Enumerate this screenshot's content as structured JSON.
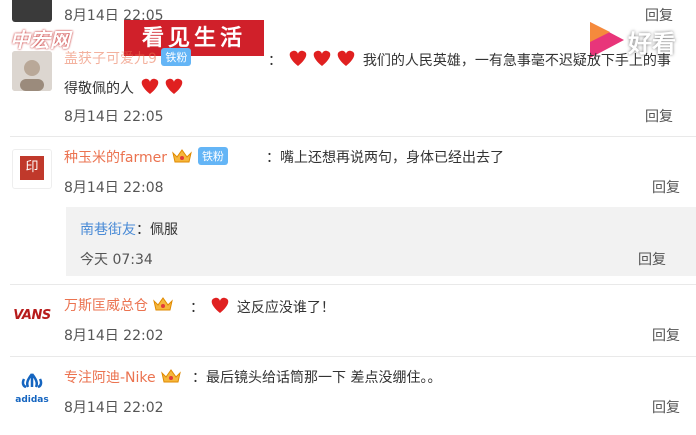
{
  "comments": [
    {
      "time": "8月14日 22:05",
      "reply": "回复"
    },
    {
      "name": "盖获子可爱九9",
      "badge": "铁粉",
      "text_before": "：",
      "text": "我们的人民英雄，一有急事毫不迟疑放下手上的事",
      "text_line2": "得敬佩的人",
      "time": "8月14日 22:05",
      "reply": "回复"
    },
    {
      "name": "种玉米的farmer",
      "badge": "铁粉",
      "text": "：嘴上还想再说两句，身体已经出去了",
      "time": "8月14日 22:08",
      "reply": "回复",
      "avatar_text": "印"
    },
    {
      "name": "南巷街友",
      "text": "：佩服",
      "time": "今天 07:34",
      "reply": "回复",
      "is_sub": true
    },
    {
      "name": "万斯匡威总仓",
      "text": "这反应没谁了！",
      "text_prefix": "：",
      "time": "8月14日 22:02",
      "reply": "回复",
      "avatar_text": "VANS"
    },
    {
      "name": "专注阿迪-Nike",
      "text": "：最后镜头给话筒那一下 差点没绷住。。",
      "time": "8月14日 22:02",
      "reply": "回复",
      "avatar_text": "adidas"
    }
  ],
  "overlay": {
    "site": "中宏网",
    "label": "看见生活"
  },
  "watermark": {
    "label": "好看"
  },
  "colors": {
    "name": "#eb7350",
    "badge": "#64b5f6",
    "heart": "#e02020",
    "overlay_red": "#d0202a"
  }
}
